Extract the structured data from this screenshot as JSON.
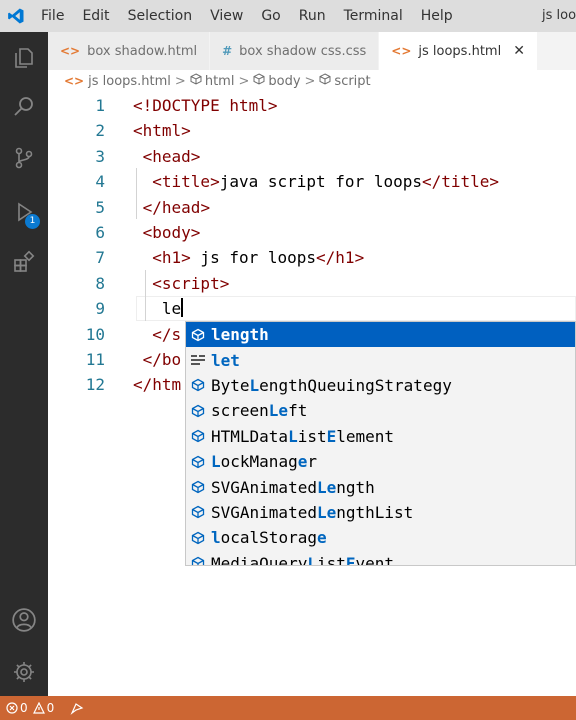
{
  "titlebar": {
    "menu": [
      "File",
      "Edit",
      "Selection",
      "View",
      "Go",
      "Run",
      "Terminal",
      "Help"
    ],
    "window_title": "js loop"
  },
  "activity": {
    "run_badge": "1"
  },
  "tabs": [
    {
      "icon": "<>",
      "label": "box shadow.html",
      "active": false
    },
    {
      "icon": "#",
      "label": "box shadow css.css",
      "active": false
    },
    {
      "icon": "<>",
      "label": "js loops.html",
      "active": true,
      "close": "✕"
    }
  ],
  "breadcrumb": {
    "icon": "<>",
    "items": [
      "js loops.html",
      "html",
      "body",
      "script"
    ],
    "separator": ">"
  },
  "code": {
    "lines": [
      {
        "n": "1",
        "indent": "",
        "parts": [
          [
            "tag",
            "<!DOCTYPE html>"
          ]
        ]
      },
      {
        "n": "2",
        "indent": "",
        "parts": [
          [
            "tag",
            "<html>"
          ]
        ]
      },
      {
        "n": "3",
        "indent": " ",
        "parts": [
          [
            "tag",
            "<head>"
          ]
        ]
      },
      {
        "n": "4",
        "indent": "  ",
        "parts": [
          [
            "tag",
            "<title>"
          ],
          [
            "txt",
            "java script for loops"
          ],
          [
            "tag",
            "</title>"
          ]
        ]
      },
      {
        "n": "5",
        "indent": " ",
        "parts": [
          [
            "tag",
            "</head>"
          ]
        ]
      },
      {
        "n": "6",
        "indent": " ",
        "parts": [
          [
            "tag",
            "<body>"
          ]
        ]
      },
      {
        "n": "7",
        "indent": "  ",
        "parts": [
          [
            "tag",
            "<h1>"
          ],
          [
            "txt",
            " js for loops"
          ],
          [
            "tag",
            "</h1>"
          ]
        ]
      },
      {
        "n": "8",
        "indent": "  ",
        "parts": [
          [
            "tag",
            "<script>"
          ]
        ]
      },
      {
        "n": "9",
        "indent": "   ",
        "parts": [
          [
            "txt",
            "le"
          ]
        ],
        "cursor": true
      },
      {
        "n": "10",
        "indent": "  ",
        "parts": [
          [
            "tag",
            "</s"
          ]
        ]
      },
      {
        "n": "11",
        "indent": " ",
        "parts": [
          [
            "tag",
            "</bo"
          ]
        ]
      },
      {
        "n": "12",
        "indent": "",
        "parts": [
          [
            "tag",
            "</htm"
          ]
        ]
      }
    ]
  },
  "suggestions": [
    {
      "icon": "field",
      "pre": "",
      "match": "length",
      "post": "",
      "selected": true
    },
    {
      "icon": "keyword",
      "pre": "",
      "match": "let",
      "post": "",
      "selected": false
    },
    {
      "icon": "field",
      "pre": "Byte",
      "match": "L",
      "mid": "ength",
      "post": "QueuingStrategy",
      "matchMid": "e",
      "selected": false
    },
    {
      "icon": "field",
      "pre": "screen",
      "match": "Le",
      "post": "ft",
      "selected": false
    },
    {
      "icon": "field",
      "pre": "HTMLData",
      "match": "L",
      "post": "ist",
      "match2": "E",
      "post2": "lement",
      "selected": false
    },
    {
      "icon": "field",
      "pre": "",
      "match": "L",
      "post": "ockManag",
      "match2": "e",
      "post2": "r",
      "selected": false
    },
    {
      "icon": "field",
      "pre": "SVGAnimated",
      "match": "Le",
      "post": "ngth",
      "selected": false
    },
    {
      "icon": "field",
      "pre": "SVGAnimated",
      "match": "Le",
      "post": "ngthList",
      "selected": false
    },
    {
      "icon": "field",
      "pre": "",
      "match": "l",
      "post": "ocalStorag",
      "match2": "e",
      "post2": "",
      "selected": false
    },
    {
      "icon": "field",
      "pre": "MediaQuery",
      "match": "L",
      "post": "ist",
      "match2": "E",
      "post2": "vent",
      "selected": false
    }
  ],
  "status": {
    "errors": "0",
    "warnings": "0"
  },
  "colors": {
    "accent": "#0060c0",
    "statusbar": "#cc6633",
    "activitybar": "#2c2c2c",
    "tag": "#800000"
  }
}
